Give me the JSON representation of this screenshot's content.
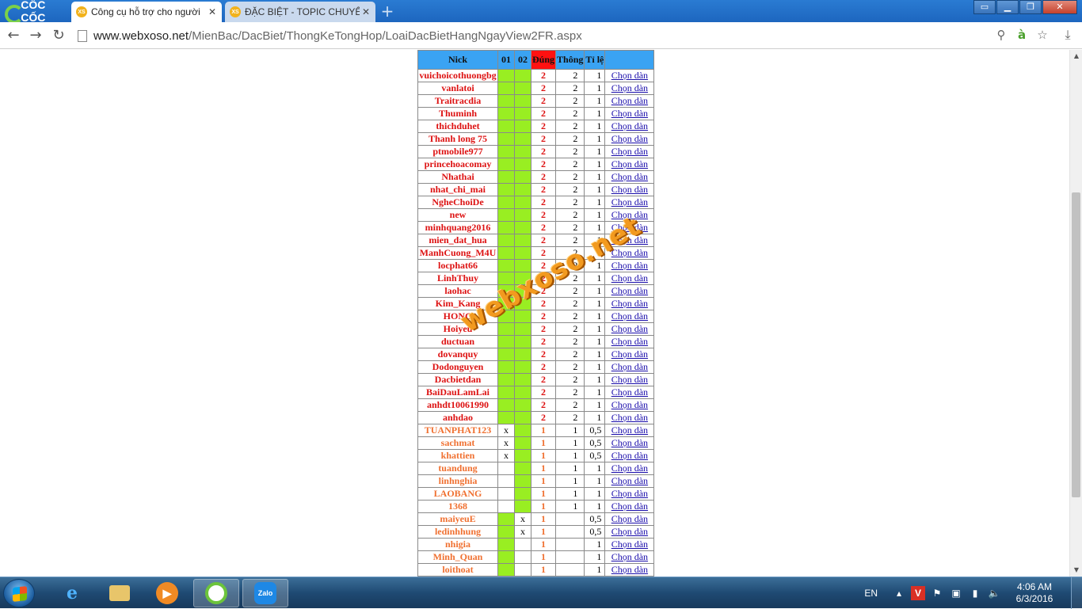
{
  "browser": {
    "logo": "CỐC CỐC",
    "tabs": [
      {
        "title": "Công cụ hỗ trợ cho người",
        "favicon": "XS",
        "active": true
      },
      {
        "title": "ĐẶC BIỆT - TOPIC CHUYÊN",
        "favicon": "XS",
        "active": false
      }
    ],
    "new_tab": "+",
    "url_host": "www.webxoso.net",
    "url_path": "/MienBac/DacBiet/ThongKeTongHop/LoaiDacBietHangNgayView2FR.aspx"
  },
  "table": {
    "headers": {
      "nick": "Nick",
      "c01": "01",
      "c02": "02",
      "dung": "Đúng",
      "thong": "Thông",
      "tile": "Tỉ lệ",
      "chon": ""
    },
    "link_text": "Chọn dàn",
    "rows": [
      {
        "nick": "vuichoicothuongbg",
        "c01": "",
        "c02": "",
        "dung": "2",
        "thong": "2",
        "tile": "1",
        "g01": true,
        "g02": true,
        "tier": "red"
      },
      {
        "nick": "vanlatoi",
        "c01": "",
        "c02": "",
        "dung": "2",
        "thong": "2",
        "tile": "1",
        "g01": true,
        "g02": true,
        "tier": "red"
      },
      {
        "nick": "Traitracdia",
        "c01": "",
        "c02": "",
        "dung": "2",
        "thong": "2",
        "tile": "1",
        "g01": true,
        "g02": true,
        "tier": "red"
      },
      {
        "nick": "Thuminh",
        "c01": "",
        "c02": "",
        "dung": "2",
        "thong": "2",
        "tile": "1",
        "g01": true,
        "g02": true,
        "tier": "red"
      },
      {
        "nick": "thichduhet",
        "c01": "",
        "c02": "",
        "dung": "2",
        "thong": "2",
        "tile": "1",
        "g01": true,
        "g02": true,
        "tier": "red"
      },
      {
        "nick": "Thanh long 75",
        "c01": "",
        "c02": "",
        "dung": "2",
        "thong": "2",
        "tile": "1",
        "g01": true,
        "g02": true,
        "tier": "red"
      },
      {
        "nick": "ptmobile977",
        "c01": "",
        "c02": "",
        "dung": "2",
        "thong": "2",
        "tile": "1",
        "g01": true,
        "g02": true,
        "tier": "red"
      },
      {
        "nick": "princehoacomay",
        "c01": "",
        "c02": "",
        "dung": "2",
        "thong": "2",
        "tile": "1",
        "g01": true,
        "g02": true,
        "tier": "red"
      },
      {
        "nick": "Nhathai",
        "c01": "",
        "c02": "",
        "dung": "2",
        "thong": "2",
        "tile": "1",
        "g01": true,
        "g02": true,
        "tier": "red"
      },
      {
        "nick": "nhat_chi_mai",
        "c01": "",
        "c02": "",
        "dung": "2",
        "thong": "2",
        "tile": "1",
        "g01": true,
        "g02": true,
        "tier": "red"
      },
      {
        "nick": "NgheChoiDe",
        "c01": "",
        "c02": "",
        "dung": "2",
        "thong": "2",
        "tile": "1",
        "g01": true,
        "g02": true,
        "tier": "red"
      },
      {
        "nick": "new",
        "c01": "",
        "c02": "",
        "dung": "2",
        "thong": "2",
        "tile": "1",
        "g01": true,
        "g02": true,
        "tier": "red"
      },
      {
        "nick": "minhquang2016",
        "c01": "",
        "c02": "",
        "dung": "2",
        "thong": "2",
        "tile": "1",
        "g01": true,
        "g02": true,
        "tier": "red"
      },
      {
        "nick": "mien_dat_hua",
        "c01": "",
        "c02": "",
        "dung": "2",
        "thong": "2",
        "tile": "1",
        "g01": true,
        "g02": true,
        "tier": "red"
      },
      {
        "nick": "ManhCuong_M4U",
        "c01": "",
        "c02": "",
        "dung": "2",
        "thong": "2",
        "tile": "1",
        "g01": true,
        "g02": true,
        "tier": "red"
      },
      {
        "nick": "locphat66",
        "c01": "",
        "c02": "",
        "dung": "2",
        "thong": "2",
        "tile": "1",
        "g01": true,
        "g02": true,
        "tier": "red"
      },
      {
        "nick": "LinhThuy",
        "c01": "",
        "c02": "",
        "dung": "2",
        "thong": "2",
        "tile": "1",
        "g01": true,
        "g02": true,
        "tier": "red"
      },
      {
        "nick": "laohac",
        "c01": "",
        "c02": "",
        "dung": "2",
        "thong": "2",
        "tile": "1",
        "g01": true,
        "g02": true,
        "tier": "red"
      },
      {
        "nick": "Kim_Kang",
        "c01": "",
        "c02": "",
        "dung": "2",
        "thong": "2",
        "tile": "1",
        "g01": true,
        "g02": true,
        "tier": "red"
      },
      {
        "nick": "HONG",
        "c01": "",
        "c02": "",
        "dung": "2",
        "thong": "2",
        "tile": "1",
        "g01": true,
        "g02": true,
        "tier": "red"
      },
      {
        "nick": "Hoiyeu",
        "c01": "",
        "c02": "",
        "dung": "2",
        "thong": "2",
        "tile": "1",
        "g01": true,
        "g02": true,
        "tier": "red"
      },
      {
        "nick": "ductuan",
        "c01": "",
        "c02": "",
        "dung": "2",
        "thong": "2",
        "tile": "1",
        "g01": true,
        "g02": true,
        "tier": "red"
      },
      {
        "nick": "dovanquy",
        "c01": "",
        "c02": "",
        "dung": "2",
        "thong": "2",
        "tile": "1",
        "g01": true,
        "g02": true,
        "tier": "red"
      },
      {
        "nick": "Dodonguyen",
        "c01": "",
        "c02": "",
        "dung": "2",
        "thong": "2",
        "tile": "1",
        "g01": true,
        "g02": true,
        "tier": "red"
      },
      {
        "nick": "Dacbietdan",
        "c01": "",
        "c02": "",
        "dung": "2",
        "thong": "2",
        "tile": "1",
        "g01": true,
        "g02": true,
        "tier": "red"
      },
      {
        "nick": "BaiDauLamLai",
        "c01": "",
        "c02": "",
        "dung": "2",
        "thong": "2",
        "tile": "1",
        "g01": true,
        "g02": true,
        "tier": "red"
      },
      {
        "nick": "anhdt10061990",
        "c01": "",
        "c02": "",
        "dung": "2",
        "thong": "2",
        "tile": "1",
        "g01": true,
        "g02": true,
        "tier": "red"
      },
      {
        "nick": "anhdao",
        "c01": "",
        "c02": "",
        "dung": "2",
        "thong": "2",
        "tile": "1",
        "g01": true,
        "g02": true,
        "tier": "red"
      },
      {
        "nick": "TUANPHAT123",
        "c01": "x",
        "c02": "",
        "dung": "1",
        "thong": "1",
        "tile": "0,5",
        "g01": false,
        "g02": true,
        "tier": "orange"
      },
      {
        "nick": "sachmat",
        "c01": "x",
        "c02": "",
        "dung": "1",
        "thong": "1",
        "tile": "0,5",
        "g01": false,
        "g02": true,
        "tier": "orange"
      },
      {
        "nick": "khattien",
        "c01": "x",
        "c02": "",
        "dung": "1",
        "thong": "1",
        "tile": "0,5",
        "g01": false,
        "g02": true,
        "tier": "orange"
      },
      {
        "nick": "tuandung",
        "c01": "",
        "c02": "",
        "dung": "1",
        "thong": "1",
        "tile": "1",
        "g01": false,
        "g02": true,
        "tier": "orange"
      },
      {
        "nick": "linhnghia",
        "c01": "",
        "c02": "",
        "dung": "1",
        "thong": "1",
        "tile": "1",
        "g01": false,
        "g02": true,
        "tier": "orange"
      },
      {
        "nick": "LAOBANG",
        "c01": "",
        "c02": "",
        "dung": "1",
        "thong": "1",
        "tile": "1",
        "g01": false,
        "g02": true,
        "tier": "orange"
      },
      {
        "nick": "1368",
        "c01": "",
        "c02": "",
        "dung": "1",
        "thong": "1",
        "tile": "1",
        "g01": false,
        "g02": true,
        "tier": "orange"
      },
      {
        "nick": "maiyeuE",
        "c01": "",
        "c02": "x",
        "dung": "1",
        "thong": "",
        "tile": "0,5",
        "g01": true,
        "g02": false,
        "tier": "orange"
      },
      {
        "nick": "ledinhhung",
        "c01": "",
        "c02": "x",
        "dung": "1",
        "thong": "",
        "tile": "0,5",
        "g01": true,
        "g02": false,
        "tier": "orange"
      },
      {
        "nick": "nhigia",
        "c01": "",
        "c02": "",
        "dung": "1",
        "thong": "",
        "tile": "1",
        "g01": true,
        "g02": false,
        "tier": "orange"
      },
      {
        "nick": "Minh_Quan",
        "c01": "",
        "c02": "",
        "dung": "1",
        "thong": "",
        "tile": "1",
        "g01": true,
        "g02": false,
        "tier": "orange"
      },
      {
        "nick": "loithoat",
        "c01": "",
        "c02": "",
        "dung": "1",
        "thong": "",
        "tile": "1",
        "g01": true,
        "g02": false,
        "tier": "orange"
      }
    ]
  },
  "watermark": "webxoso.net",
  "taskbar": {
    "apps": [
      "Internet Explorer",
      "Windows Explorer",
      "Media Player",
      "Cốc Cốc",
      "Zalo"
    ],
    "zalo_label": "Zalo",
    "lang": "EN",
    "time": "4:06 AM",
    "date": "6/3/2016"
  },
  "colors": {
    "header_blue": "#3aa3f3",
    "header_red": "#ff1111",
    "cell_green": "#99ee22",
    "nick_red": "#dd1111",
    "nick_orange": "#f07030",
    "link": "#1a0dab"
  }
}
